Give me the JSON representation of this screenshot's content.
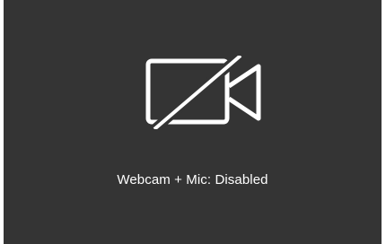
{
  "webcam_panel": {
    "status_text": "Webcam + Mic: Disabled",
    "icon": "camera-off-icon",
    "background_color": "#343434",
    "foreground_color": "#ffffff"
  }
}
